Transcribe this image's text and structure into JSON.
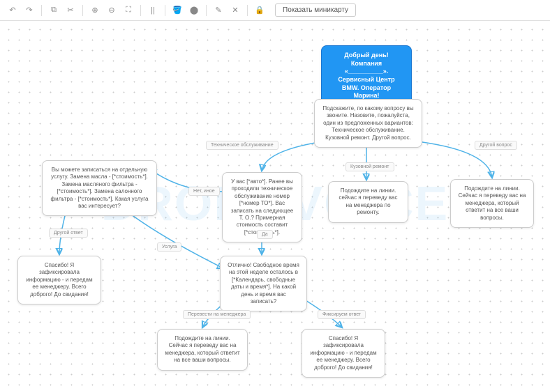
{
  "toolbar": {
    "minimap_label": "Показать миникарту"
  },
  "watermark": "DROBOVOICE",
  "nodes": {
    "start": "Добрый день! Компания «__________». Сервисный Центр BMW. Оператор Марина!",
    "question": "Подскажите, по какому вопросу вы звоните. Назовите, пожалуйста, один из предложенных вариантов: Техническое обслуживание. Кузовной ремонт. Другой вопрос.",
    "tech": "У вас [*авто*]. Ранее вы проходили техническое обслуживание номер [*номер ТО*]. Вас  записать на следующее Т. О.? Примерная стоимость составит [*стоимость*].",
    "body_repair": "Подождите на линии. сейчас я переведу вас на менеджера по ремонту.",
    "other_q": "Подождите на линии. Сейчас я переведу вас на менеджера, который ответит на все ваши вопросы.",
    "services": "Вы можете записаться на отдельную услугу. Замена масла - [*стоимость*]. Замена масляного фильтра - [*стоимость*]. Замена салонного фильтра - [*стоимость*]. Какая услуга вас интересует?",
    "schedule": "Отлично! Свободное время на этой неделе осталось в [*Календарь, свободные даты и время*]. На какой день и время вас записать?",
    "thanks1": "Спасибо! Я зафиксировала информацию  - и передам ее менеджеру. Всего доброго! До свидания!",
    "thanks2": "Спасибо! Я зафиксировала информацию  - и передам ее менеджеру. Всего доброго! До свидания!",
    "manager": "Подождите на линии. Сейчас я переведу вас на менеджера, который ответит на все ваши вопросы."
  },
  "edges": {
    "tech_service": "Техническое обслуживание",
    "body_repair": "Кузовной ремонт",
    "other": "Другой вопрос",
    "no_other": "Нет, иное",
    "yes": "Да",
    "other_answer": "Другой ответ",
    "service": "Услуга",
    "to_manager": "Перевести на менеджера",
    "fix_answer": "Фиксируем ответ"
  }
}
